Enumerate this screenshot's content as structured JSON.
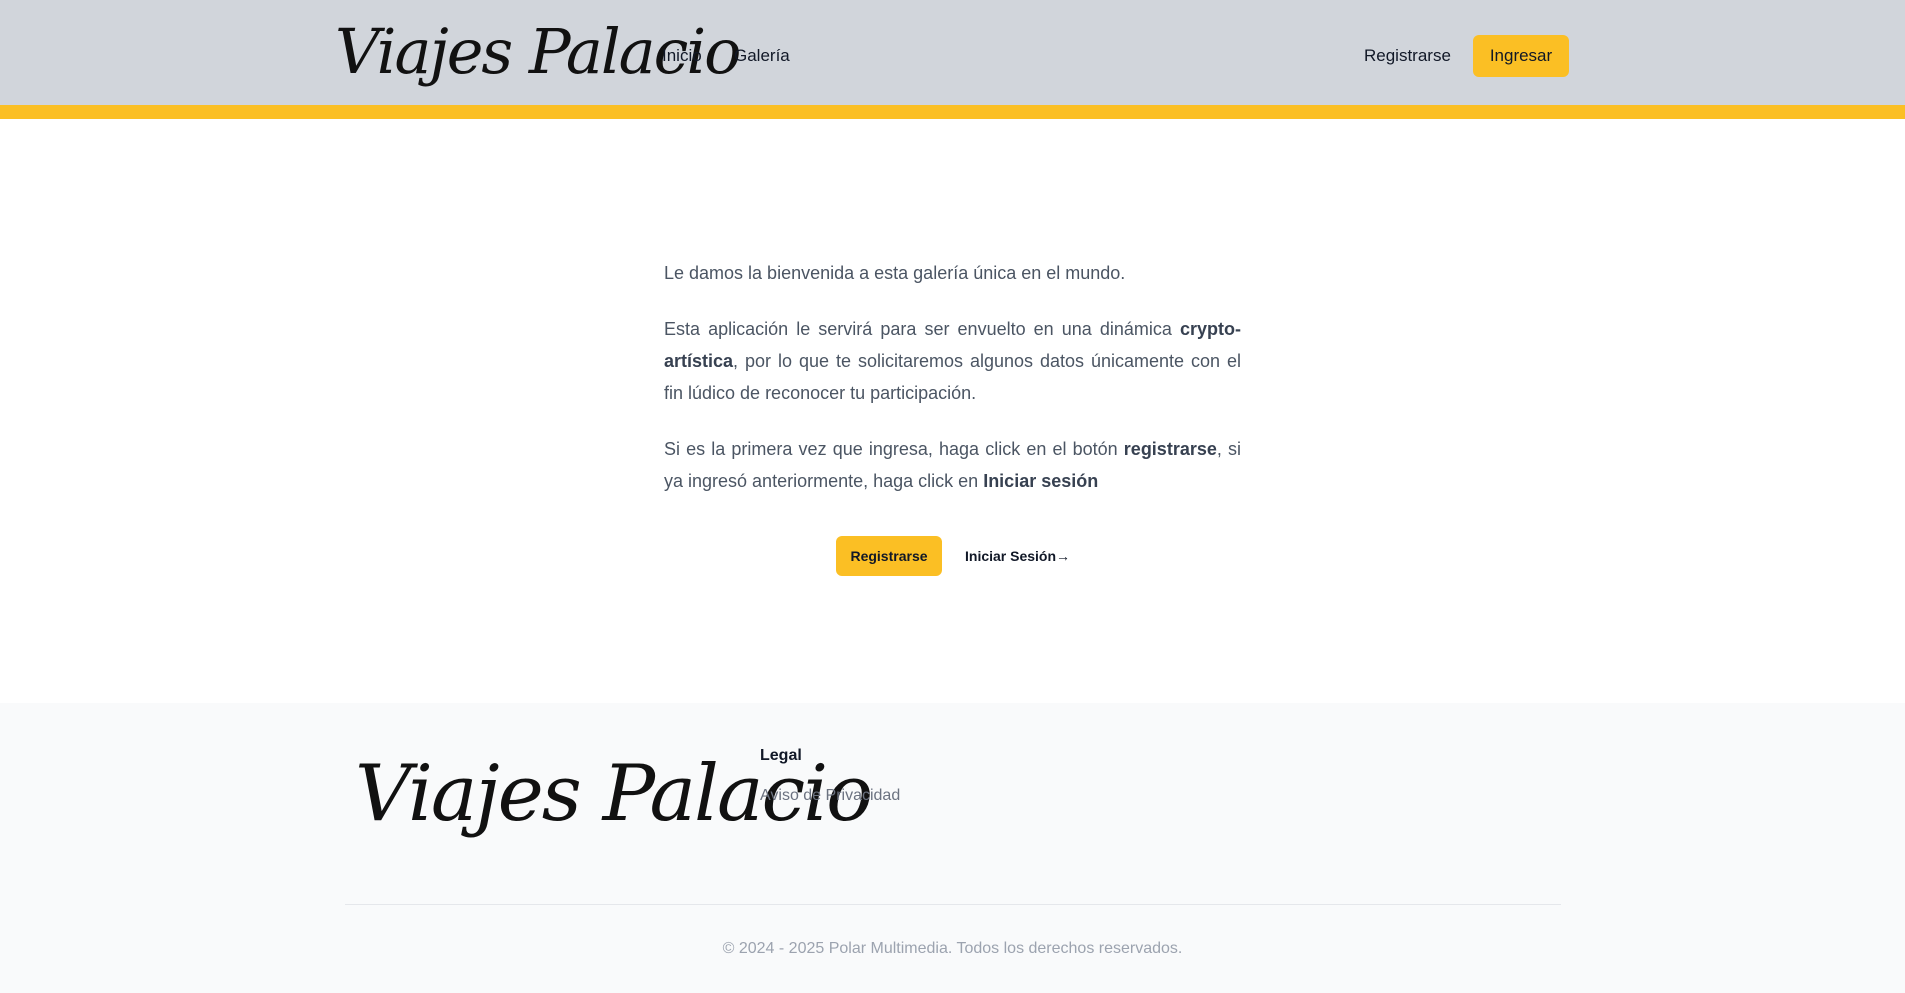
{
  "header": {
    "logo_text": "Viajes Palacio",
    "nav": [
      {
        "label": "Inicio"
      },
      {
        "label": "Galería"
      }
    ],
    "register_label": "Registrarse",
    "login_label": "Ingresar"
  },
  "main": {
    "para1": "Le damos la bienvenida a esta galería única en el mundo.",
    "para2": {
      "before": "Esta aplicación le servirá para ser envuelto en una dinámica ",
      "bold": "crypto-artística",
      "after": ", por lo que te solicitaremos algunos datos únicamente con el fin lúdico de reconocer tu participación."
    },
    "para3": {
      "before": "Si es la primera vez que ingresa, haga click en el botón ",
      "bold1": "registrarse",
      "middle": ", si ya ingresó anteriormente, haga click en ",
      "bold2": "Iniciar sesión"
    },
    "cta_register_label": "Registrarse",
    "cta_login_label": "Iniciar Sesión",
    "cta_login_arrow": "→"
  },
  "footer": {
    "logo_text": "Viajes Palacio",
    "legal_heading": "Legal",
    "privacy_link": "Aviso de Privacidad",
    "copyright": "© 2024 - 2025 Polar Multimedia. Todos los derechos reservados."
  },
  "colors": {
    "header_bg": "#d1d5db",
    "accent": "#fbbf24",
    "footer_bg": "#f9fafb"
  }
}
